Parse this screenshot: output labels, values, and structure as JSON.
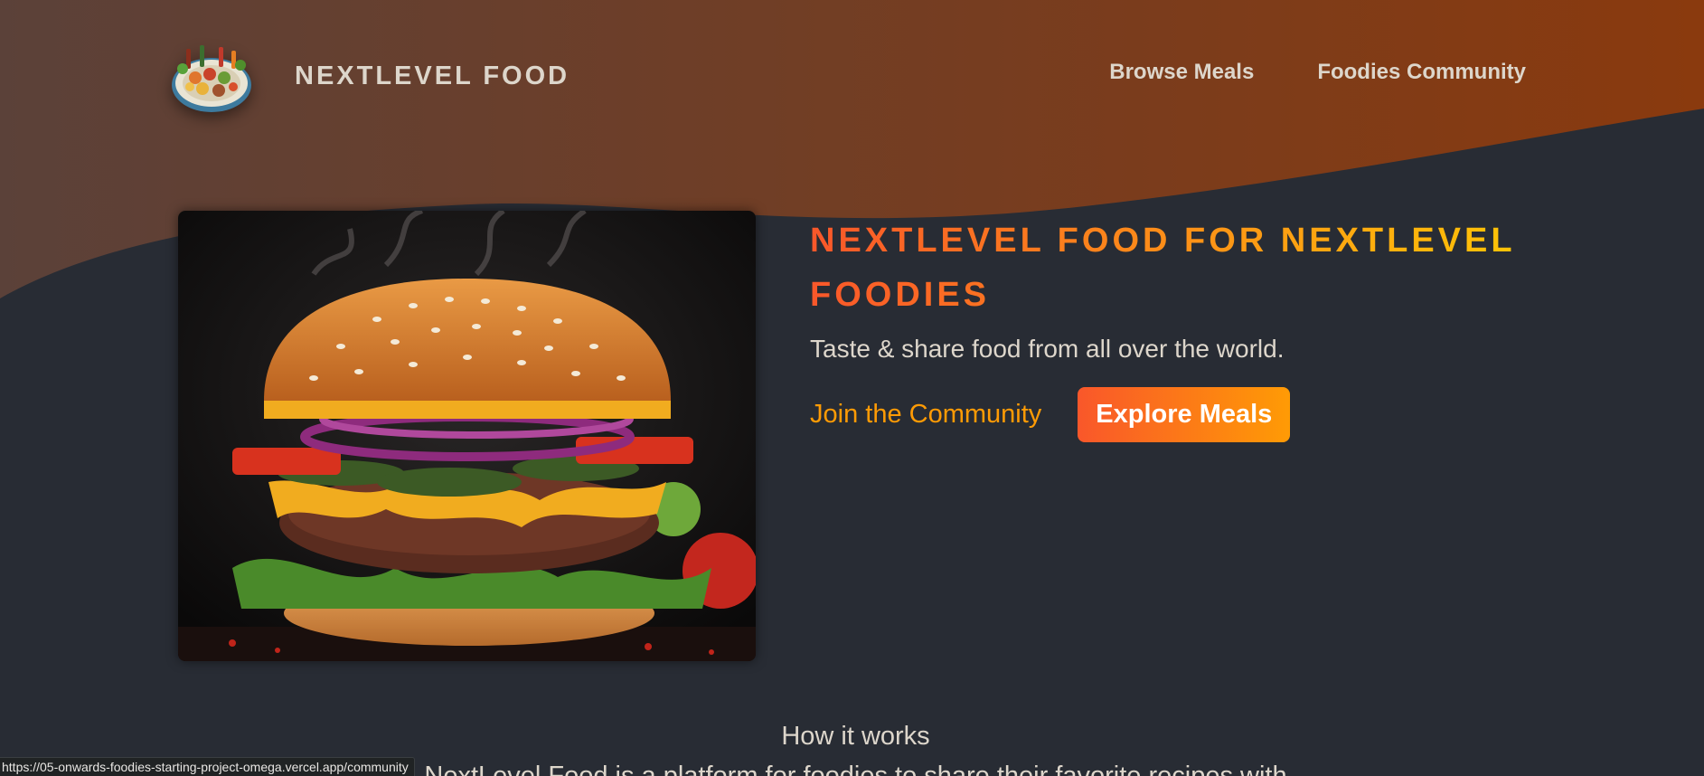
{
  "header": {
    "logo_alt": "A plate with food on it",
    "logo_text": "NextLevel Food",
    "nav": [
      {
        "label": "Browse Meals"
      },
      {
        "label": "Foodies Community"
      }
    ]
  },
  "hero": {
    "image_alt": "A delicious, juicy burger",
    "title": "NextLevel Food for NextLevel Foodies",
    "subtitle": "Taste & share food from all over the world.",
    "join_link": "Join the Community",
    "explore_button": "Explore Meals"
  },
  "section": {
    "title": "How it works",
    "text": "NextLevel Food is a platform for foodies to share their favorite recipes with"
  },
  "status_bar": {
    "url": "https://05-onwards-foodies-starting-project-omega.vercel.app/community"
  },
  "colors": {
    "background": "#282c34",
    "header_gradient_start": "#5b4139",
    "header_gradient_end": "#8a3a0e",
    "title_gradient_start": "#f9572a",
    "title_gradient_end": "#ffc905",
    "link_orange": "#ff9b05",
    "text": "#ddd6cb"
  },
  "icons": {
    "logo": "food-plate-icon"
  }
}
